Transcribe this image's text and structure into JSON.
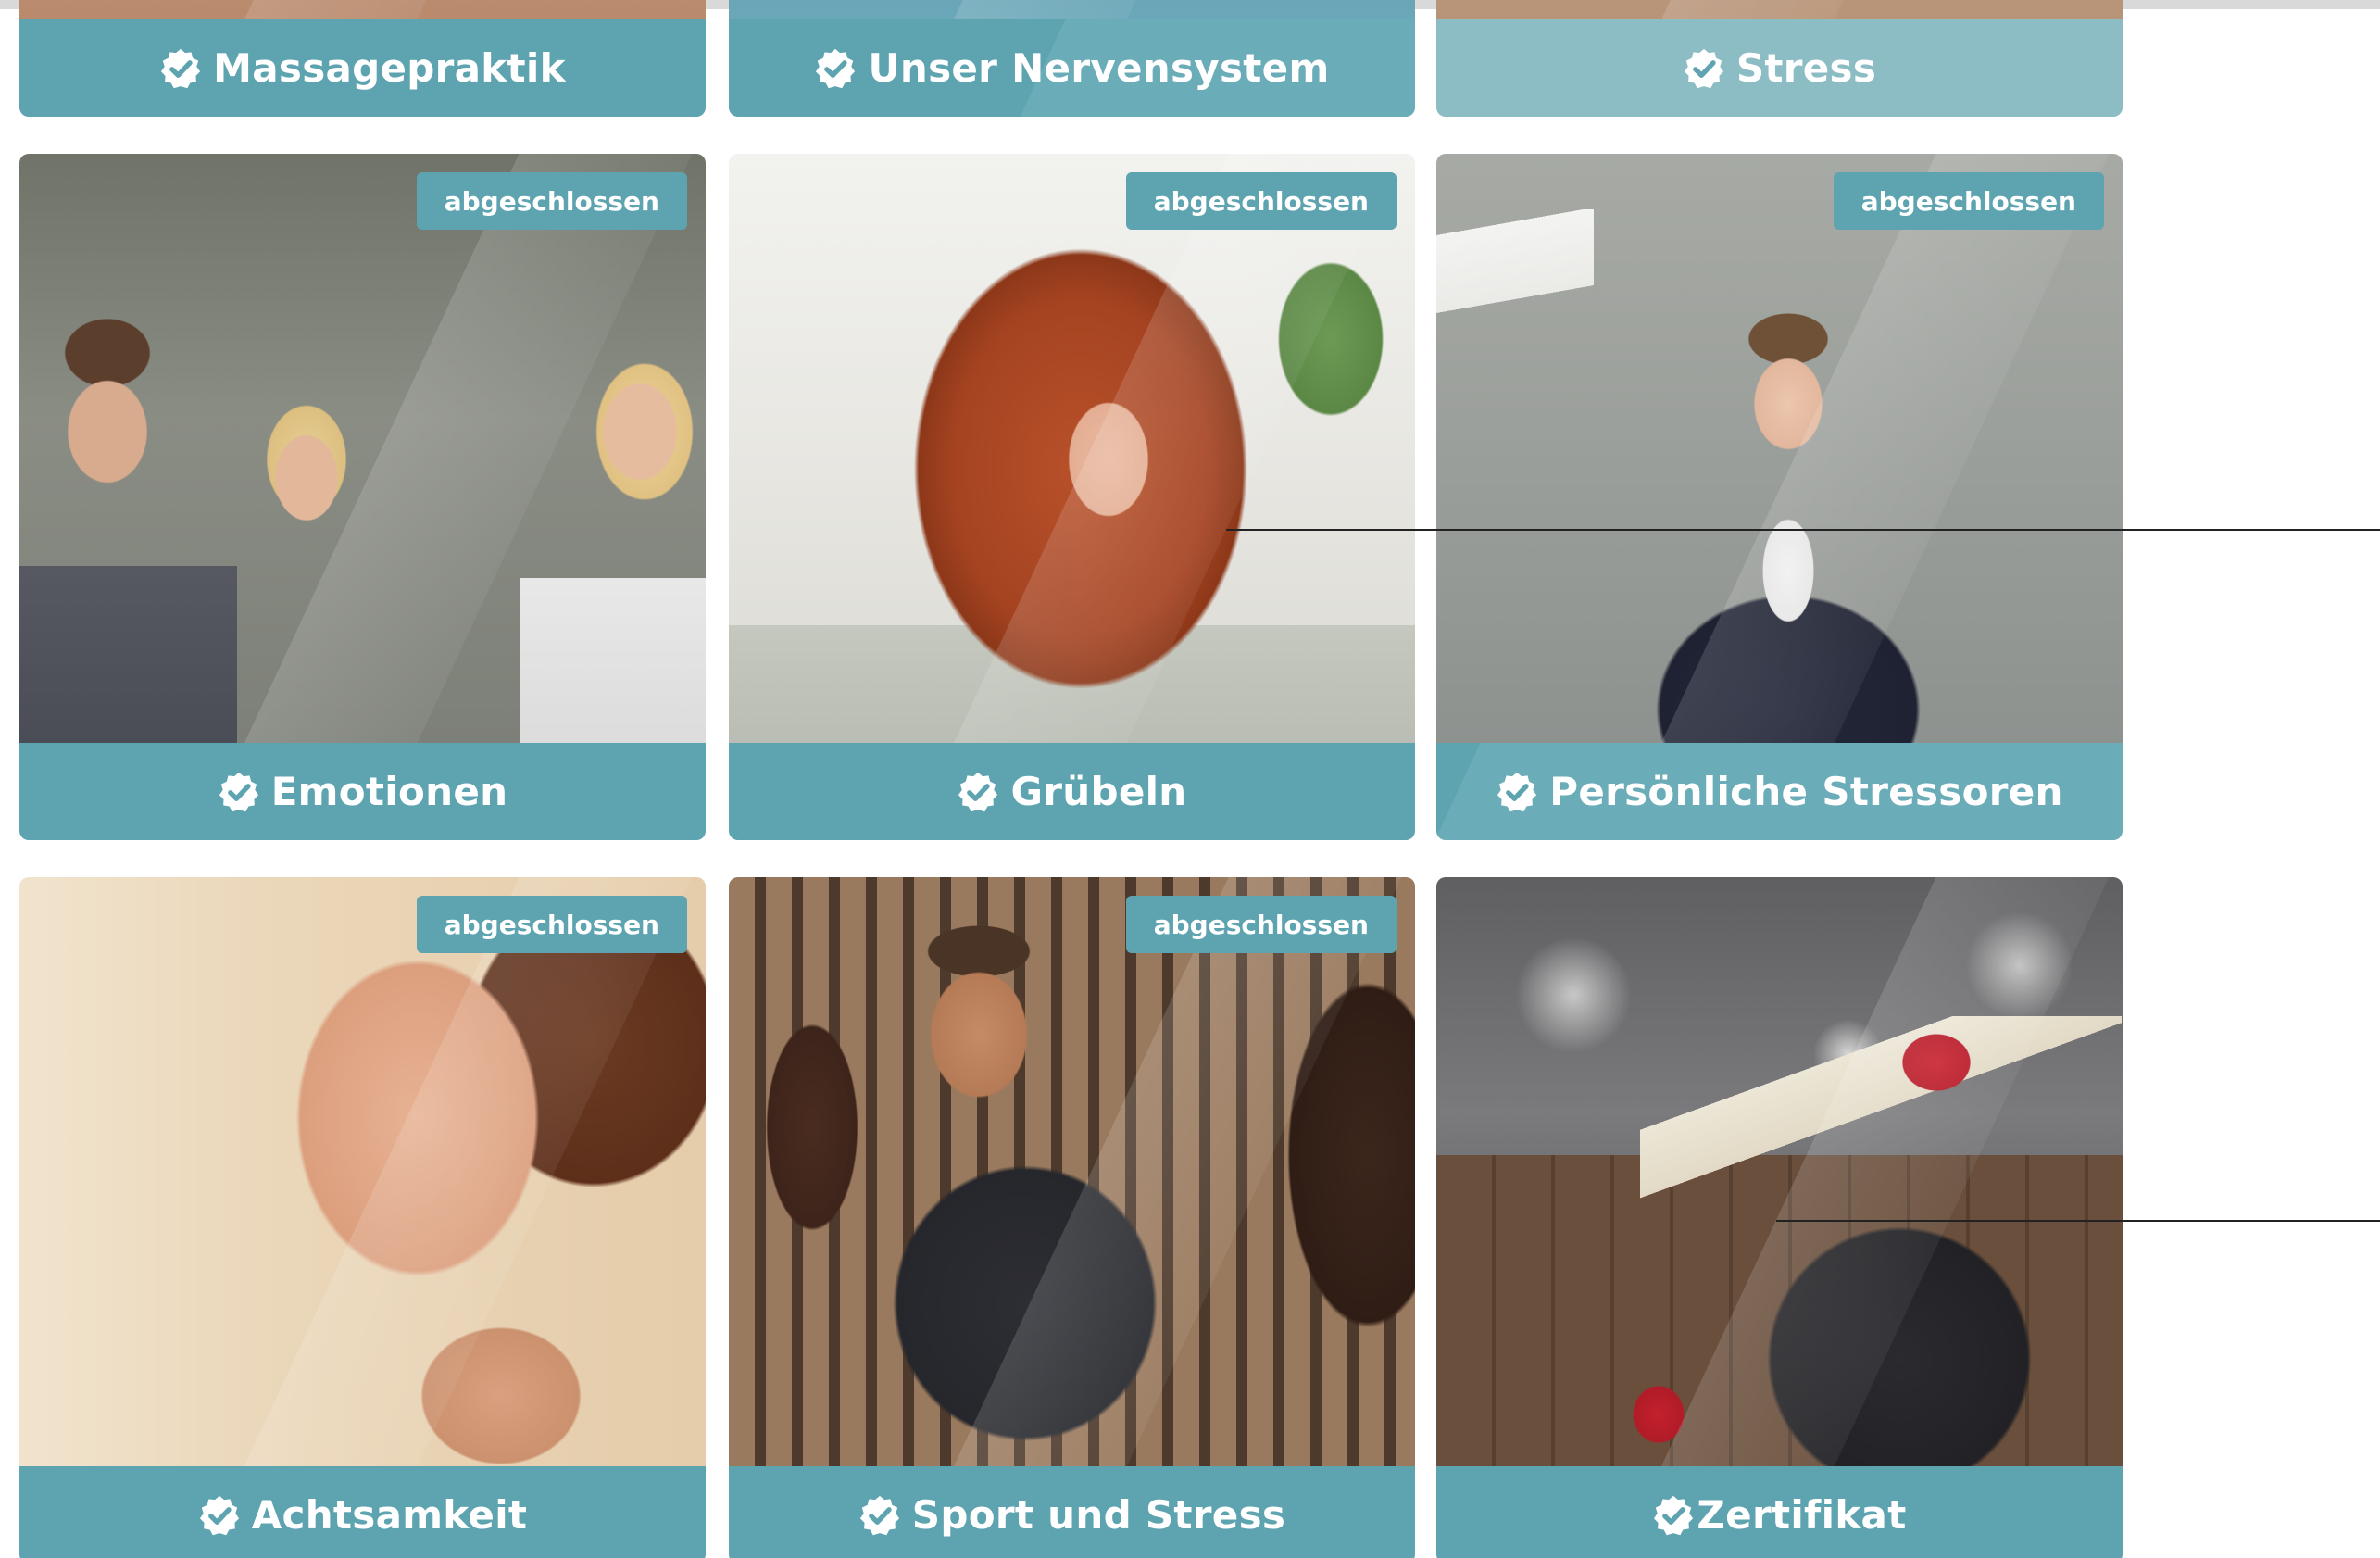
{
  "colors": {
    "footer_primary": "#5ea4b0",
    "footer_light": "#8cbcc4",
    "status_badge": "#5ea4b0",
    "topbar": "#d9d9d9"
  },
  "course_cards": [
    {
      "title": "Massagepraktik",
      "icon": "verified-badge-icon",
      "status": ""
    },
    {
      "title": "Unser Nervensystem",
      "icon": "verified-badge-icon",
      "status": ""
    },
    {
      "title": "Stress",
      "icon": "verified-badge-icon",
      "status": ""
    },
    {
      "title": "Emotionen",
      "icon": "verified-badge-icon",
      "status": "abgeschlossen"
    },
    {
      "title": "Grübeln",
      "icon": "verified-badge-icon",
      "status": "abgeschlossen"
    },
    {
      "title": "Persönliche Stressoren",
      "icon": "verified-badge-icon",
      "status": "abgeschlossen"
    },
    {
      "title": "Achtsamkeit",
      "icon": "verified-badge-icon",
      "status": "abgeschlossen"
    },
    {
      "title": "Sport und Stress",
      "icon": "verified-badge-icon",
      "status": "abgeschlossen"
    },
    {
      "title": "Zertifikat",
      "icon": "verified-badge-icon",
      "status": ""
    }
  ]
}
